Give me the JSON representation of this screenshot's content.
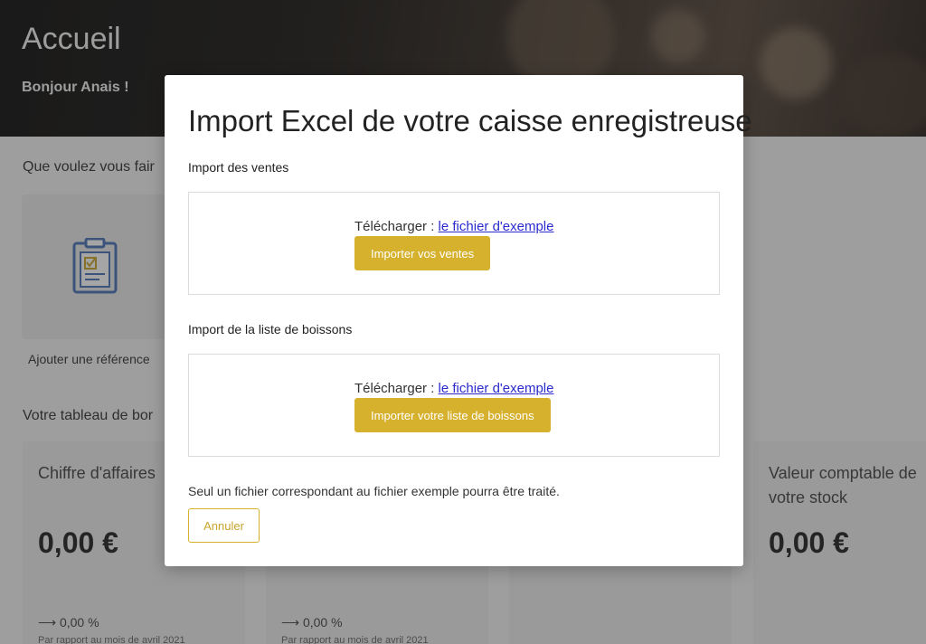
{
  "page": {
    "title": "Accueil",
    "greeting": "Bonjour Anais !",
    "actions_heading": "Que voulez vous fair",
    "action_card_label": "Ajouter une référence",
    "dashboard_heading": "Votre tableau de bor"
  },
  "stats": [
    {
      "title": "Chiffre d'affaires",
      "value": "0,00 €",
      "delta": "⟶ 0,00 %",
      "note": "Par rapport au mois de avril 2021"
    },
    {
      "title": "",
      "value": "",
      "delta": "⟶ 0,00 %",
      "note": "Par rapport au mois de avril 2021"
    },
    {
      "title": "",
      "value": "",
      "delta": "",
      "note": ""
    },
    {
      "title": "Valeur comptable de votre stock",
      "value": "0,00 €",
      "delta": "",
      "note": ""
    }
  ],
  "modal": {
    "title": "Import Excel de votre caisse enregistreuse",
    "sales_section": {
      "heading": "Import des ventes",
      "download_prefix": "Télécharger : ",
      "download_link": "le fichier d'exemple",
      "button": "Importer vos ventes"
    },
    "drinks_section": {
      "heading": "Import de la liste de boissons",
      "download_prefix": "Télécharger : ",
      "download_link": "le fichier d'exemple",
      "button": "Importer votre liste de boissons"
    },
    "note": "Seul un fichier correspondant au fichier exemple pourra être traité.",
    "cancel_button": "Annuler"
  },
  "colors": {
    "accent_gold": "#d6b12e",
    "link_blue": "#2a2acd",
    "clipboard_blue": "#4a74b8"
  },
  "icons": {
    "action_card": "clipboard-check-icon"
  }
}
